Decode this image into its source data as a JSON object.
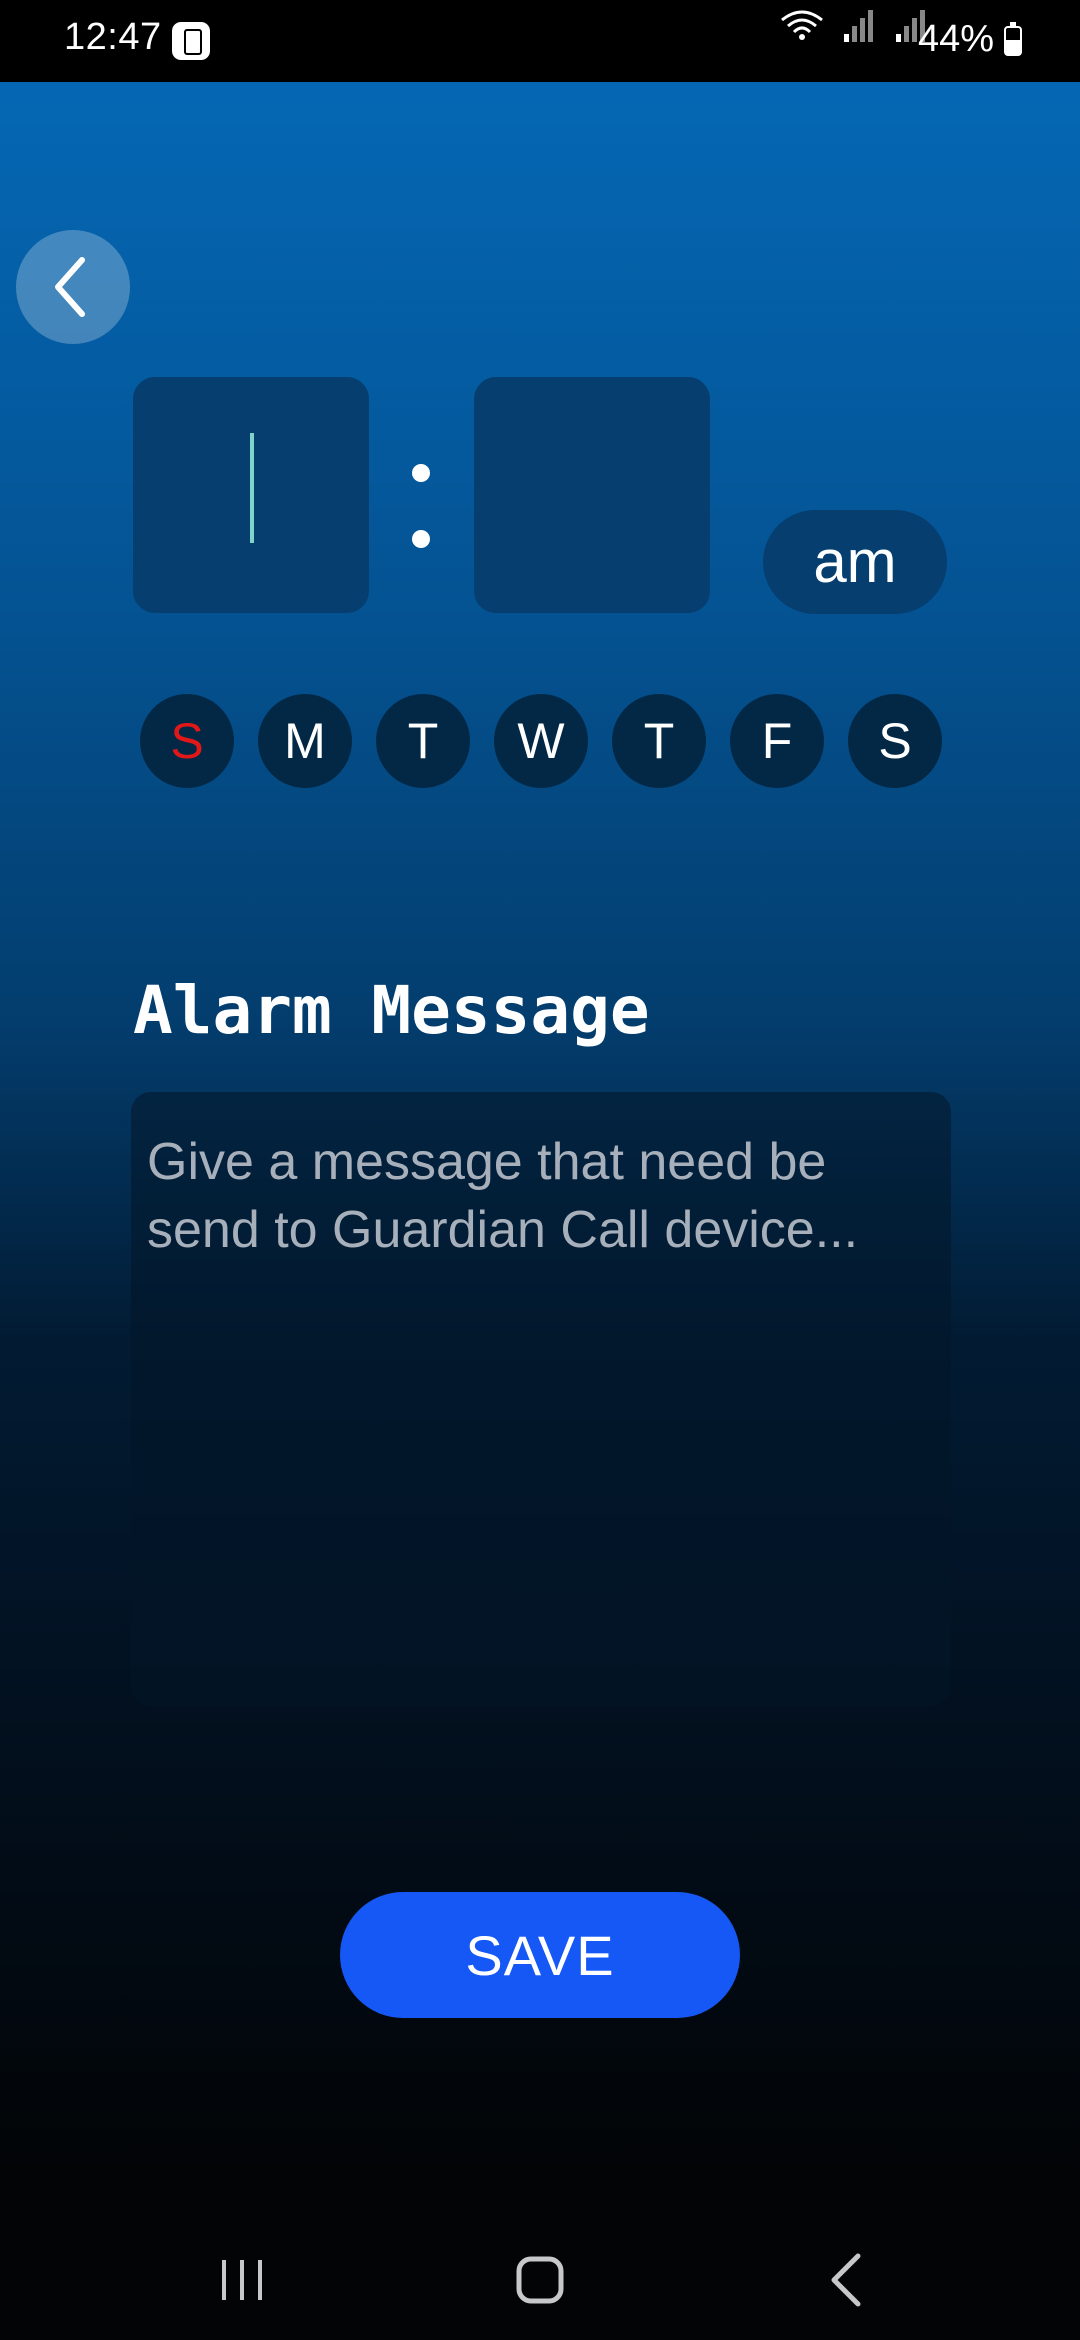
{
  "status_bar": {
    "time": "12:47",
    "battery": "44%",
    "icons": [
      "sim-icon",
      "wifi-icon",
      "signal-icon",
      "signal-icon",
      "battery-icon"
    ]
  },
  "header": {
    "back_icon": "chevron-left-icon"
  },
  "time_picker": {
    "hour_value": "",
    "minute_value": "",
    "separator": ":",
    "period": "am"
  },
  "days": [
    {
      "label": "S",
      "color": "#e01818"
    },
    {
      "label": "M",
      "color": "#ffffff"
    },
    {
      "label": "T",
      "color": "#ffffff"
    },
    {
      "label": "W",
      "color": "#ffffff"
    },
    {
      "label": "T",
      "color": "#ffffff"
    },
    {
      "label": "F",
      "color": "#ffffff"
    },
    {
      "label": "S",
      "color": "#ffffff"
    }
  ],
  "alarm_message": {
    "title": "Alarm Message",
    "placeholder": "Give a message that need be send to Guardian Call device...",
    "value": ""
  },
  "actions": {
    "save_label": "SAVE"
  },
  "colors": {
    "accent": "#1658f5",
    "gradient_top": "#0567b4",
    "gradient_bottom": "#020406",
    "highlight_day": "#e01818"
  },
  "nav_bar": {
    "icons": [
      "recents-icon",
      "home-icon",
      "back-icon"
    ]
  }
}
